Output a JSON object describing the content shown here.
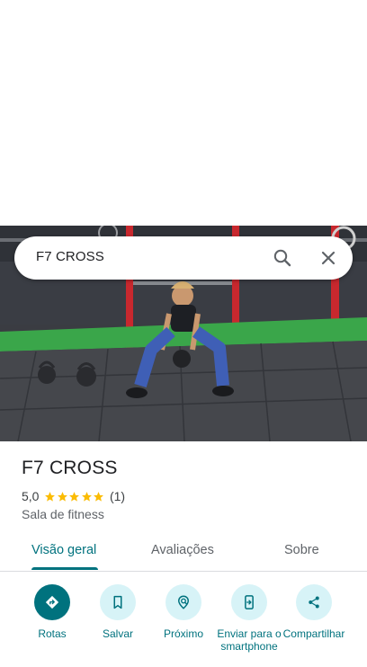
{
  "search": {
    "query": "F7 CROSS"
  },
  "icons": {
    "search": "search-icon",
    "close": "close-icon",
    "star": "star-icon"
  },
  "place": {
    "name": "F7 CROSS",
    "rating": "5,0",
    "stars": 5,
    "review_count": "(1)",
    "category": "Sala de fitness"
  },
  "tabs": [
    {
      "label": "Visão geral",
      "active": true
    },
    {
      "label": "Avaliações",
      "active": false
    },
    {
      "label": "Sobre",
      "active": false
    }
  ],
  "actions": [
    {
      "label": "Rotas",
      "icon": "directions-icon"
    },
    {
      "label": "Salvar",
      "icon": "bookmark-icon"
    },
    {
      "label": "Próximo",
      "icon": "nearby-icon"
    },
    {
      "label": "Enviar para o smartphone",
      "icon": "send-to-phone-icon"
    },
    {
      "label": "Compartilhar",
      "icon": "share-icon"
    }
  ],
  "colors": {
    "accent": "#00727e",
    "accent_light": "#d7f3f7",
    "star": "#fbbc04",
    "text_primary": "#202124",
    "text_secondary": "#5f6368"
  }
}
